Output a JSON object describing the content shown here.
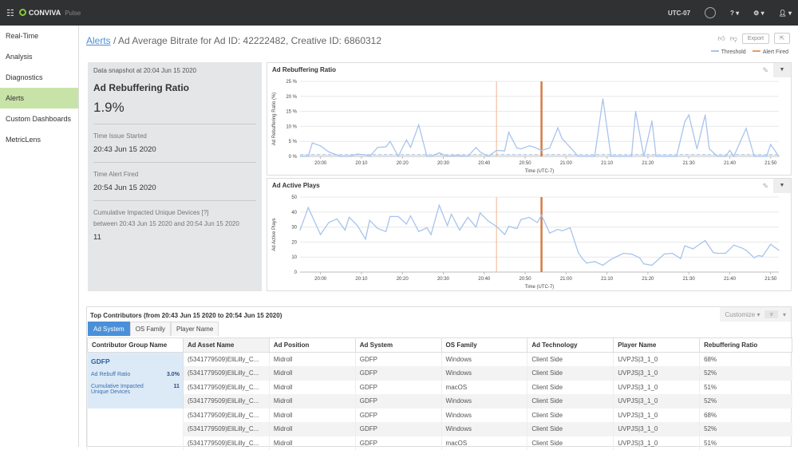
{
  "topbar": {
    "brand": "CONVIVA",
    "product": "Pulse",
    "timezone": "UTC-07",
    "help": "?",
    "icons": [
      "grid-menu-icon",
      "notification-icon",
      "help-icon",
      "gear-icon",
      "user-icon"
    ]
  },
  "sidebar": {
    "items": [
      {
        "label": "Real-Time"
      },
      {
        "label": "Analysis"
      },
      {
        "label": "Diagnostics"
      },
      {
        "label": "Alerts",
        "active": true
      },
      {
        "label": "Custom Dashboards"
      },
      {
        "label": "MetricLens"
      }
    ]
  },
  "breadcrumb": {
    "link": "Alerts",
    "title": " / Ad Average Bitrate for Ad ID: 42222482, Creative ID: 6860312"
  },
  "actions": {
    "export": "Export"
  },
  "legend": {
    "threshold": "Threshold",
    "alert": "Alert Fired"
  },
  "colors": {
    "series": "#a8c4ec",
    "threshold": "#a8c4ec",
    "alert_start": "#f2b48f",
    "alert_fired": "#d77a45",
    "accent": "#4a90d9",
    "sidebar_active": "#c8e3a8"
  },
  "snapshot": {
    "header": "Data snapshot at 20:04 Jun 15 2020",
    "metric": "Ad Rebuffering Ratio",
    "value": "1.9%",
    "started_label": "Time Issue Started",
    "started": "20:43 Jun 15 2020",
    "fired_label": "Time Alert Fired",
    "fired": "20:54 Jun 15 2020",
    "impacted_label": "Cumulative Impacted Unique Devices [?]",
    "impacted_range": "between 20:43 Jun 15 2020 and 20:54 Jun 15 2020",
    "impacted": "11"
  },
  "chart_data": [
    {
      "type": "line",
      "title": "Ad Rebuffering Ratio",
      "ylabel": "Ad Rebuffering Ratio (%)",
      "xlabel": "Time (UTC-7)",
      "ylim": [
        0,
        25
      ],
      "yticks": [
        "0 %",
        "5 %",
        "10 %",
        "15 %",
        "20 %",
        "25 %"
      ],
      "xticks": [
        "20:00",
        "20:10",
        "20:20",
        "20:30",
        "20:40",
        "20:50",
        "21:00",
        "21:10",
        "21:20",
        "21:30",
        "21:40",
        "21:50"
      ],
      "xlim": [
        "19:55",
        "21:52"
      ],
      "grid": true,
      "threshold": 0.6,
      "alert_lines": [
        "20:43",
        "20:54"
      ],
      "x": [
        "19:55",
        "19:57",
        "19:58",
        "20:00",
        "20:02",
        "20:05",
        "20:07",
        "20:09",
        "20:11",
        "20:12",
        "20:14",
        "20:16",
        "20:17",
        "20:19",
        "20:21",
        "20:22",
        "20:24",
        "20:26",
        "20:27",
        "20:29",
        "20:31",
        "20:33",
        "20:36",
        "20:38",
        "20:39",
        "20:41",
        "20:43",
        "20:45",
        "20:46",
        "20:48",
        "20:49",
        "20:51",
        "20:52",
        "20:54",
        "20:56",
        "20:58",
        "20:59",
        "21:01",
        "21:03",
        "21:07",
        "21:09",
        "21:11",
        "21:16",
        "21:17",
        "21:19",
        "21:21",
        "21:22",
        "21:27",
        "21:29",
        "21:30",
        "21:32",
        "21:34",
        "21:35",
        "21:37",
        "21:39",
        "21:40",
        "21:41",
        "21:44",
        "21:46",
        "21:49",
        "21:50",
        "21:52"
      ],
      "y": [
        0,
        0,
        4.5,
        3.5,
        1.5,
        0,
        0,
        0.8,
        0.5,
        0,
        3,
        3.2,
        5,
        0,
        5.5,
        3,
        10.5,
        0,
        0,
        1.2,
        0,
        0.3,
        0,
        3,
        1.5,
        0,
        2,
        1.8,
        8,
        2.8,
        2.5,
        3.5,
        3.2,
        2,
        2.8,
        9.5,
        6,
        3,
        0,
        0,
        19.2,
        0,
        0,
        15,
        0,
        11.8,
        0,
        0,
        11.5,
        13.8,
        2.5,
        13.8,
        2.5,
        0,
        0,
        2,
        0,
        9.3,
        0,
        0,
        4,
        0
      ]
    },
    {
      "type": "line",
      "title": "Ad Active Plays",
      "ylabel": "Ad Active Plays",
      "xlabel": "Time (UTC-7)",
      "ylim": [
        0,
        50
      ],
      "yticks": [
        "0",
        "10",
        "20",
        "30",
        "40",
        "50"
      ],
      "xticks": [
        "20:00",
        "20:10",
        "20:20",
        "20:30",
        "20:40",
        "20:50",
        "21:00",
        "21:10",
        "21:20",
        "21:30",
        "21:40",
        "21:50"
      ],
      "xlim": [
        "19:55",
        "21:52"
      ],
      "grid": true,
      "alert_lines": [
        "20:43",
        "20:54"
      ],
      "x": [
        "19:55",
        "19:57",
        "19:58",
        "20:00",
        "20:02",
        "20:04",
        "20:06",
        "20:07",
        "20:09",
        "20:11",
        "20:12",
        "20:14",
        "20:16",
        "20:17",
        "20:19",
        "20:21",
        "20:22",
        "20:24",
        "20:26",
        "20:27",
        "20:29",
        "20:31",
        "20:32",
        "20:34",
        "20:36",
        "20:38",
        "20:39",
        "20:41",
        "20:43",
        "20:45",
        "20:46",
        "20:48",
        "20:49",
        "20:51",
        "20:53",
        "20:54",
        "20:56",
        "20:58",
        "20:59",
        "21:01",
        "21:03",
        "21:04",
        "21:05",
        "21:07",
        "21:09",
        "21:11",
        "21:14",
        "21:16",
        "21:18",
        "21:19",
        "21:21",
        "21:24",
        "21:26",
        "21:28",
        "21:29",
        "21:31",
        "21:34",
        "21:36",
        "21:37",
        "21:39",
        "21:41",
        "21:43",
        "21:44",
        "21:46",
        "21:47",
        "21:48",
        "21:50",
        "21:52"
      ],
      "y": [
        28,
        43,
        37,
        25,
        33,
        35.5,
        28,
        36.5,
        31,
        22,
        34.5,
        29,
        27,
        37,
        37,
        32,
        37.5,
        27,
        29.5,
        25,
        44.5,
        31,
        38.5,
        28,
        36.5,
        30,
        39.5,
        34,
        30.5,
        25,
        30.5,
        29,
        35,
        36.5,
        33,
        38,
        26,
        28.5,
        27.5,
        29.5,
        13,
        9,
        6,
        7,
        4.5,
        8.5,
        12.5,
        12,
        9.5,
        5.5,
        4.5,
        12,
        12.5,
        9,
        17.5,
        15.5,
        21,
        13,
        12.5,
        12.5,
        18,
        16,
        14.5,
        9.5,
        11,
        10.5,
        18.5,
        14.5
      ]
    }
  ],
  "contributors": {
    "title": "Top Contributors (from 20:43 Jun 15 2020 to 20:54 Jun 15 2020)",
    "customize": "Customize ▾",
    "tabs": [
      "Ad System",
      "OS Family",
      "Player Name"
    ],
    "columns": [
      "Contributor Group Name",
      "Ad Asset Name",
      "Ad Position",
      "Ad System",
      "OS Family",
      "Ad Technology",
      "Player Name",
      "Rebuffering Ratio"
    ],
    "group": {
      "name": "GDFP",
      "ratio_label": "Ad Rebuff Ratio",
      "ratio": "3.0%",
      "devices_label": "Cumulative Impacted Unique Devices",
      "devices": "11"
    },
    "rows": [
      [
        "(5341779509)EliLilly_C...",
        "Midroll",
        "GDFP",
        "Windows",
        "Client Side",
        "UVPJS|3_1_0",
        "68%"
      ],
      [
        "(5341779509)EliLilly_C...",
        "Midroll",
        "GDFP",
        "Windows",
        "Client Side",
        "UVPJS|3_1_0",
        "52%"
      ],
      [
        "(5341779509)EliLilly_C...",
        "Midroll",
        "GDFP",
        "macOS",
        "Client Side",
        "UVPJS|3_1_0",
        "51%"
      ],
      [
        "(5341779509)EliLilly_C...",
        "Midroll",
        "GDFP",
        "Windows",
        "Client Side",
        "UVPJS|3_1_0",
        "52%"
      ],
      [
        "(5341779509)EliLilly_C...",
        "Midroll",
        "GDFP",
        "Windows",
        "Client Side",
        "UVPJS|3_1_0",
        "68%"
      ],
      [
        "(5341779509)EliLilly_C...",
        "Midroll",
        "GDFP",
        "Windows",
        "Client Side",
        "UVPJS|3_1_0",
        "52%"
      ],
      [
        "(5341779509)EliLilly_C...",
        "Midroll",
        "GDFP",
        "macOS",
        "Client Side",
        "UVPJS|3_1_0",
        "51%"
      ]
    ]
  }
}
